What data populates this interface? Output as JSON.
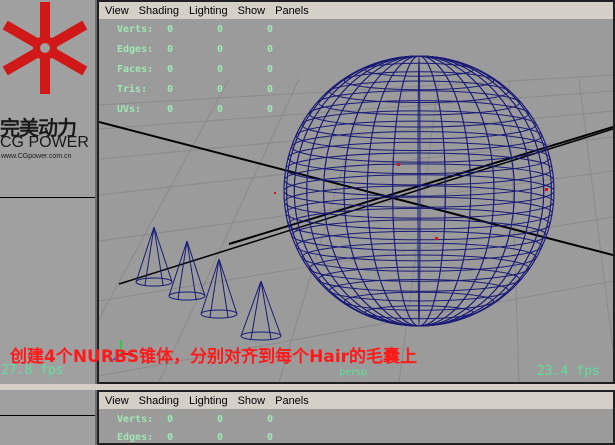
{
  "menu": [
    "View",
    "Shading",
    "Lighting",
    "Show",
    "Panels"
  ],
  "hud": {
    "rows": [
      {
        "label": "Verts:",
        "values": [
          "0",
          "0",
          "0"
        ]
      },
      {
        "label": "Edges:",
        "values": [
          "0",
          "0",
          "0"
        ]
      },
      {
        "label": "Faces:",
        "values": [
          "0",
          "0",
          "0"
        ]
      },
      {
        "label": "Tris:",
        "values": [
          "0",
          "0",
          "0"
        ]
      },
      {
        "label": "UVs:",
        "values": [
          "0",
          "0",
          "0"
        ]
      }
    ]
  },
  "hud_bottom": {
    "rows": [
      {
        "label": "Verts:",
        "values": [
          "0",
          "0",
          "0"
        ]
      },
      {
        "label": "Edges:",
        "values": [
          "0",
          "0",
          "0"
        ]
      }
    ]
  },
  "left_fps": "27.8 fps",
  "main_fps": "23.4 fps",
  "camera_label": "persp",
  "caption": "创建4个NURBS锥体，分别对齐到每个Hair的毛囊上",
  "logo": {
    "cn": "完美动力",
    "en": "CG POWER",
    "url": "www.CGpower.com.cn"
  },
  "colors": {
    "wireframe": "#1a1a78",
    "hud_text": "#9fe7b6",
    "caption": "#ff1a1a",
    "logo_red": "#d01818"
  }
}
